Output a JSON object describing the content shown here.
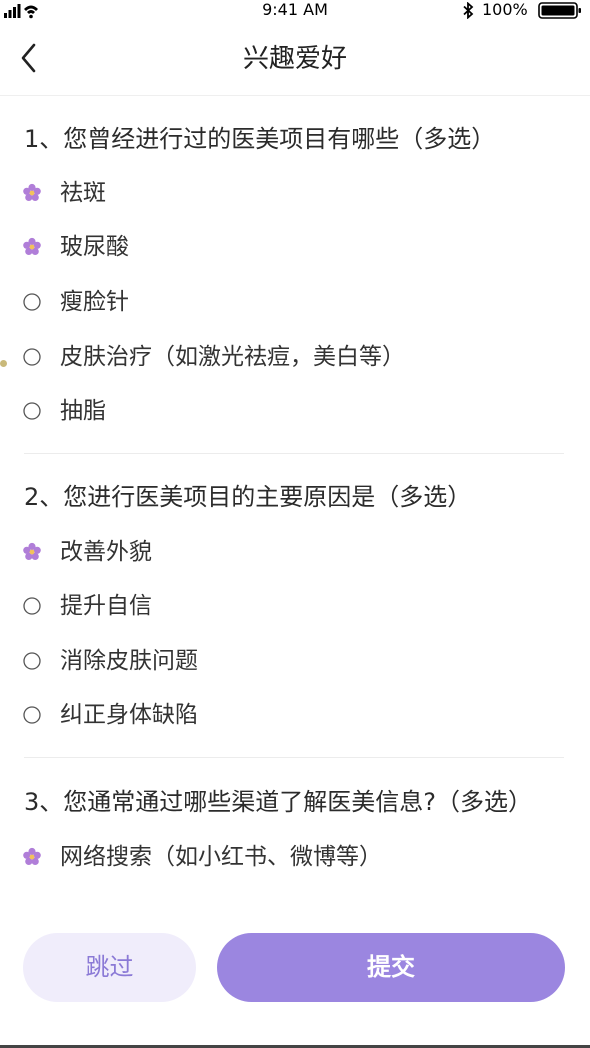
{
  "status_bar": {
    "time": "9:41 AM",
    "battery": "100%"
  },
  "nav": {
    "title": "兴趣爱好",
    "back_icon": "chevron-left-icon"
  },
  "colors": {
    "accent": "#9b86e0",
    "skip_bg": "#f0edfb",
    "skip_text": "#8b7ad6",
    "selected_flower": "#b07ed8"
  },
  "questions": [
    {
      "title": "1、您曾经进行过的医美项目有哪些（多选）",
      "options": [
        {
          "label": "祛斑",
          "selected": true
        },
        {
          "label": "玻尿酸",
          "selected": true
        },
        {
          "label": "瘦脸针",
          "selected": false
        },
        {
          "label": "皮肤治疗（如激光祛痘，美白等）",
          "selected": false
        },
        {
          "label": "抽脂",
          "selected": false
        }
      ]
    },
    {
      "title": "2、您进行医美项目的主要原因是（多选）",
      "options": [
        {
          "label": "改善外貌",
          "selected": true
        },
        {
          "label": "提升自信",
          "selected": false
        },
        {
          "label": "消除皮肤问题",
          "selected": false
        },
        {
          "label": "纠正身体缺陷",
          "selected": false
        }
      ]
    },
    {
      "title": "3、您通常通过哪些渠道了解医美信息?（多选）",
      "options": [
        {
          "label": "网络搜索（如小红书、微博等）",
          "selected": true
        }
      ]
    }
  ],
  "actions": {
    "skip_label": "跳过",
    "submit_label": "提交"
  }
}
